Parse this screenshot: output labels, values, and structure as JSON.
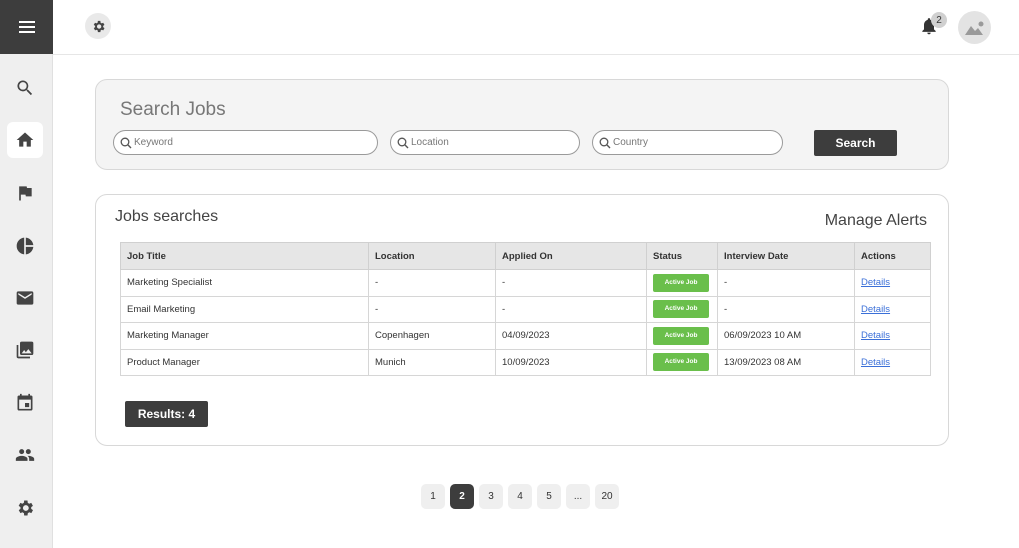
{
  "sidebar": {
    "items": [
      {
        "icon": "search-icon",
        "name": "sidebar-item-search"
      },
      {
        "icon": "home-icon",
        "name": "sidebar-item-home",
        "active": true
      },
      {
        "icon": "flag-icon",
        "name": "sidebar-item-flag"
      },
      {
        "icon": "pie-chart-icon",
        "name": "sidebar-item-reports"
      },
      {
        "icon": "mail-icon",
        "name": "sidebar-item-mail"
      },
      {
        "icon": "gallery-icon",
        "name": "sidebar-item-gallery"
      },
      {
        "icon": "calendar-icon",
        "name": "sidebar-item-calendar"
      },
      {
        "icon": "people-icon",
        "name": "sidebar-item-people"
      },
      {
        "icon": "gear-icon",
        "name": "sidebar-item-settings"
      }
    ]
  },
  "header": {
    "notification_count": "2"
  },
  "search": {
    "title": "Search Jobs",
    "keyword_placeholder": "Keyword",
    "location_placeholder": "Location",
    "country_placeholder": "Country",
    "button_label": "Search"
  },
  "jobs": {
    "title": "Jobs searches",
    "manage_alerts": "Manage Alerts",
    "columns": [
      "Job Title",
      "Location",
      "Applied On",
      "Status",
      "Interview Date",
      "Actions"
    ],
    "rows": [
      {
        "title": "Marketing Specialist",
        "location": "-",
        "applied": "-",
        "status": "Active Job",
        "interview": "-",
        "action": "Details"
      },
      {
        "title": "Email Marketing",
        "location": "-",
        "applied": "-",
        "status": "Active Job",
        "interview": "-",
        "action": "Details"
      },
      {
        "title": "Marketing Manager",
        "location": "Copenhagen",
        "applied": "04/09/2023",
        "status": "Active Job",
        "interview": "06/09/2023  10 AM",
        "action": "Details"
      },
      {
        "title": "Product Manager",
        "location": "Munich",
        "applied": "10/09/2023",
        "status": "Active Job",
        "interview": "13/09/2023 08 AM",
        "action": "Details"
      }
    ],
    "results_label": "Results: 4"
  },
  "pagination": {
    "pages": [
      "1",
      "2",
      "3",
      "4",
      "5",
      "...",
      "20"
    ],
    "current": "2"
  },
  "colors": {
    "dark": "#3d3d3d",
    "status_green": "#6abf4b",
    "link_blue": "#3a6fd8",
    "sidebar_bg": "#efefef"
  }
}
